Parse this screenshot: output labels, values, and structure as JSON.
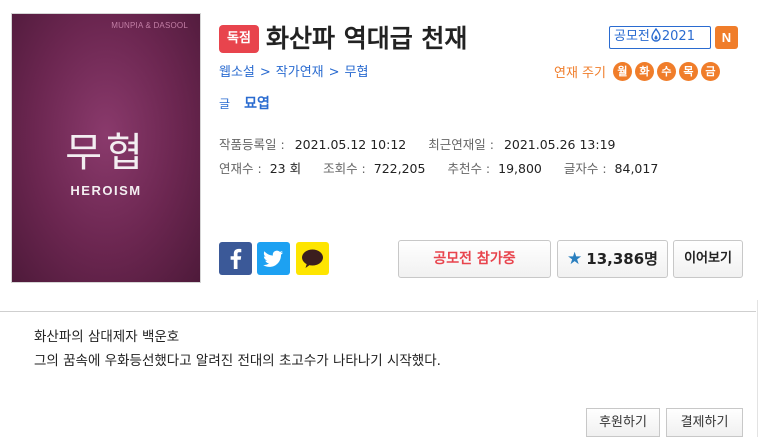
{
  "cover": {
    "publisher": "MUNPIA & DASOOL",
    "genre": "무협",
    "genre_en": "HEROISM"
  },
  "badge_exclusive": "독점",
  "title": "화산파 역대급 천재",
  "contest_badge": {
    "pre": "공모전",
    "year": "2021"
  },
  "new_badge": "N",
  "breadcrumb": [
    "웹소설",
    "작가연재",
    "무협"
  ],
  "breadcrumb_sep": ">",
  "schedule": {
    "label": "연재 주기",
    "days": [
      "월",
      "화",
      "수",
      "목",
      "금"
    ]
  },
  "author": {
    "label": "글",
    "name": "묘엽"
  },
  "stats": {
    "registered_label": "작품등록일 :",
    "registered_value": "2021.05.12 10:12",
    "latest_label": "최근연재일 :",
    "latest_value": "2021.05.26 13:19",
    "chapters_label": "연재수 :",
    "chapters_value": "23 회",
    "views_label": "조회수 :",
    "views_value": "722,205",
    "recommends_label": "추천수 :",
    "recommends_value": "19,800",
    "chars_label": "글자수 :",
    "chars_value": "84,017"
  },
  "share_icons": [
    "facebook-icon",
    "twitter-icon",
    "kakaotalk-icon"
  ],
  "buttons": {
    "contest": "공모전 참가중",
    "favorites": "13,386명",
    "continue": "이어보기",
    "support": "후원하기",
    "pay": "결제하기"
  },
  "synopsis": [
    "화산파의 삼대제자 백운호",
    "그의 꿈속에 우화등선했다고 알려진 전대의 초고수가 나타나기 시작했다."
  ],
  "colors": {
    "accent_blue": "#2a6bd0",
    "accent_orange": "#f07d2a",
    "exclusive_red": "#e8444d",
    "cover_purple": "#6b2650"
  }
}
